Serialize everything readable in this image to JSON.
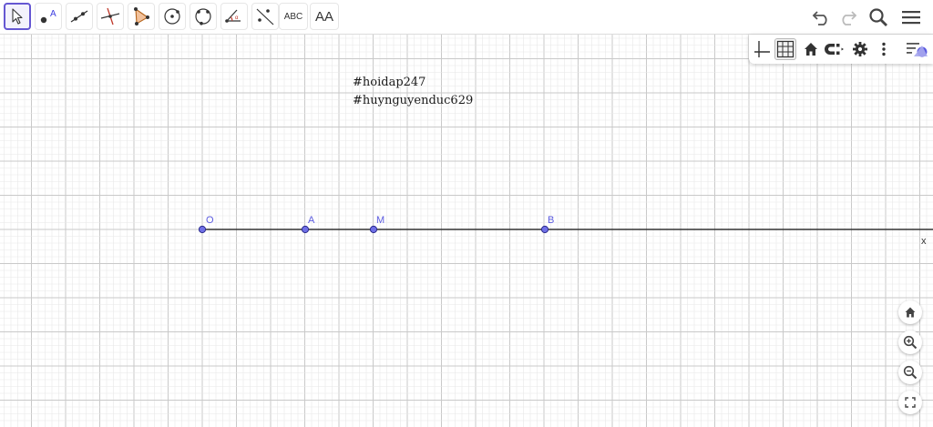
{
  "toolbar": {
    "tools": [
      {
        "name": "move-tool",
        "icon": "arrow-cursor-icon"
      },
      {
        "name": "point-tool",
        "icon": "point-icon"
      },
      {
        "name": "line-tool",
        "icon": "line-icon"
      },
      {
        "name": "perpendicular-line-tool",
        "icon": "perpendicular-icon"
      },
      {
        "name": "polygon-tool",
        "icon": "polygon-icon"
      },
      {
        "name": "circle-center-point-tool",
        "icon": "circle-center-icon"
      },
      {
        "name": "circle-three-points-tool",
        "icon": "circle-three-points-icon"
      },
      {
        "name": "angle-tool",
        "icon": "angle-icon"
      },
      {
        "name": "reflect-tool",
        "icon": "reflect-icon"
      },
      {
        "name": "text-tool",
        "icon": "text-icon",
        "label": "ABC"
      },
      {
        "name": "slider-tool",
        "icon": "text-style-icon",
        "label": "AA"
      }
    ],
    "right": [
      "undo-icon",
      "redo-icon",
      "search-icon",
      "menu-icon"
    ]
  },
  "style_bar": [
    "axes-icon",
    "grid-icon",
    "home-icon",
    "magnet-icon",
    "gear-icon",
    "more-vertical-icon",
    "graphics-settings-icon"
  ],
  "zoom_controls": [
    "home-icon",
    "zoom-in-icon",
    "zoom-out-icon",
    "fullscreen-icon"
  ],
  "canvas": {
    "notes": [
      "#hoidap247",
      "#huynguyenduc629"
    ],
    "ray_label": "x",
    "points": [
      {
        "label": "O"
      },
      {
        "label": "A"
      },
      {
        "label": "M"
      },
      {
        "label": "B"
      }
    ]
  },
  "colors": {
    "accent": "#6557d2",
    "point_fill": "#6f6fe6",
    "point_label": "#5b5be0",
    "grid_minor": "#e8e8e8",
    "grid_major": "#c9c9c9"
  }
}
